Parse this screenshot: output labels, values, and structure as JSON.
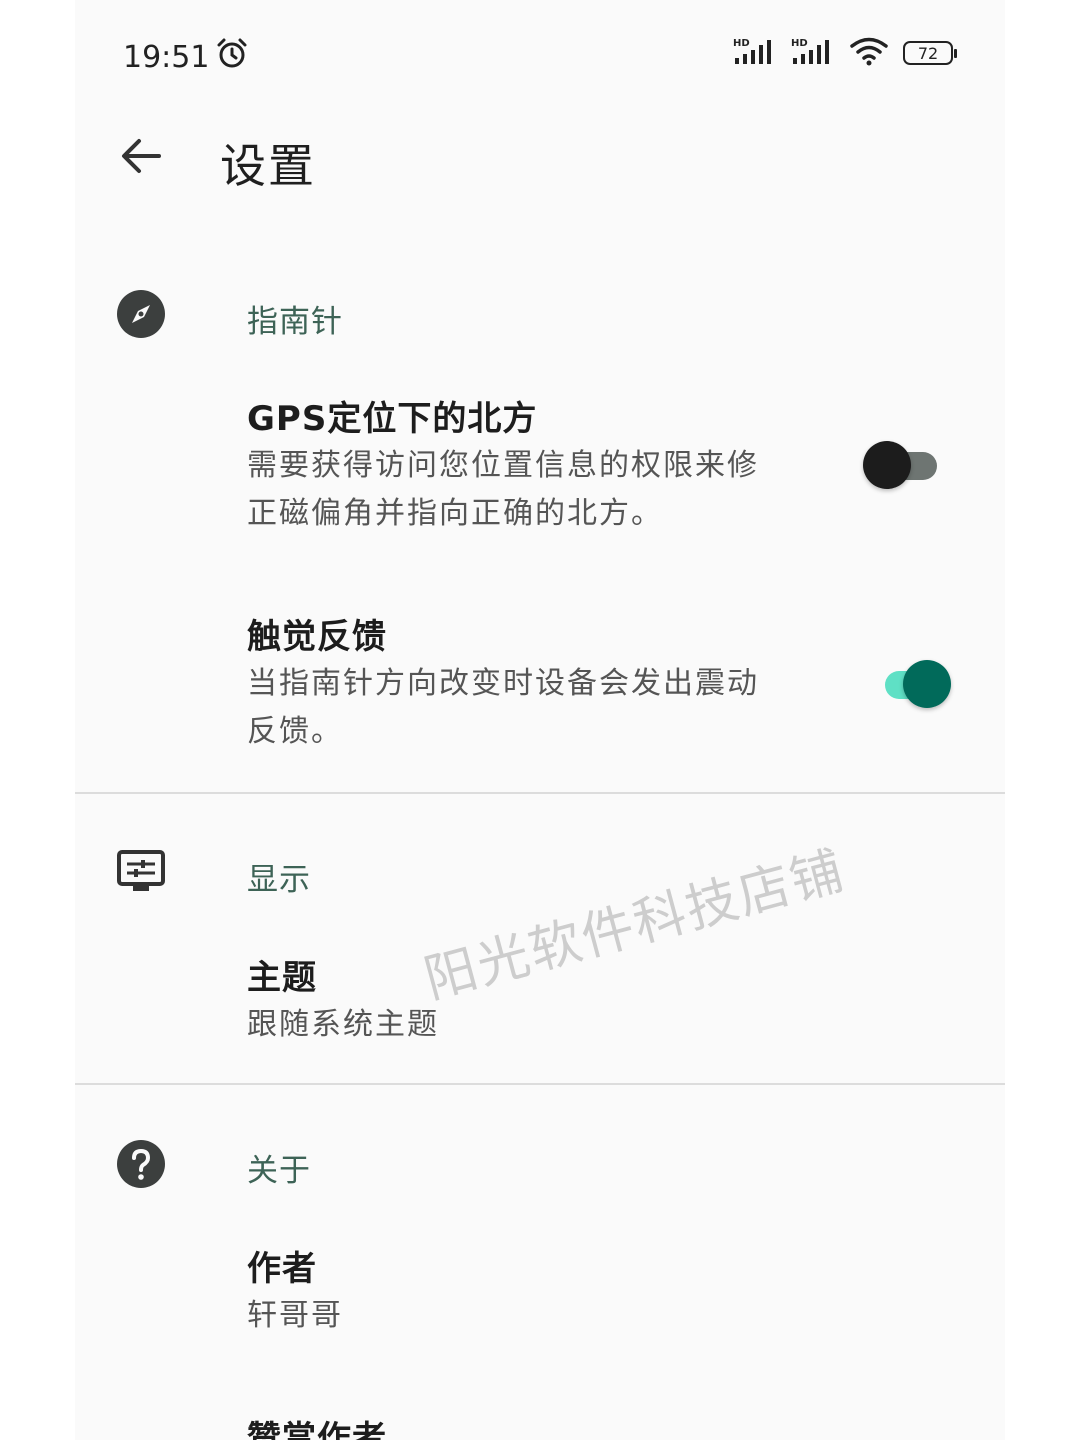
{
  "status_bar": {
    "time": "19:51",
    "battery": "72",
    "icons": [
      "alarm-icon",
      "hd-signal-icon",
      "hd-signal-icon",
      "wifi-icon",
      "battery-icon"
    ]
  },
  "header": {
    "title": "设置",
    "back_icon": "arrow-left-icon"
  },
  "sections": {
    "compass": {
      "title": "指南针",
      "icon": "compass-icon",
      "items": [
        {
          "title": "GPS定位下的北方",
          "summary_line1": "需要获得访问您位置信息的权限来修",
          "summary_line2": "正磁偏角并指向正确的北方。",
          "switch_on": false
        },
        {
          "title": "触觉反馈",
          "summary_line1": "当指南针方向改变时设备会发出震动",
          "summary_line2": "反馈。",
          "switch_on": true
        }
      ]
    },
    "display": {
      "title": "显示",
      "icon": "display-settings-icon",
      "items": [
        {
          "title": "主题",
          "summary": "跟随系统主题"
        }
      ]
    },
    "about": {
      "title": "关于",
      "icon": "help-icon",
      "items": [
        {
          "title": "作者",
          "summary": "轩哥哥"
        },
        {
          "title": "赞赏作者"
        }
      ]
    }
  },
  "watermark": "阳光软件科技店铺",
  "colors": {
    "accent": "#3d6356",
    "switch_on_track": "#5fe0c5",
    "switch_on_thumb": "#016a5a",
    "switch_off_track": "#6e7572",
    "switch_off_thumb": "#1c1c1c"
  }
}
